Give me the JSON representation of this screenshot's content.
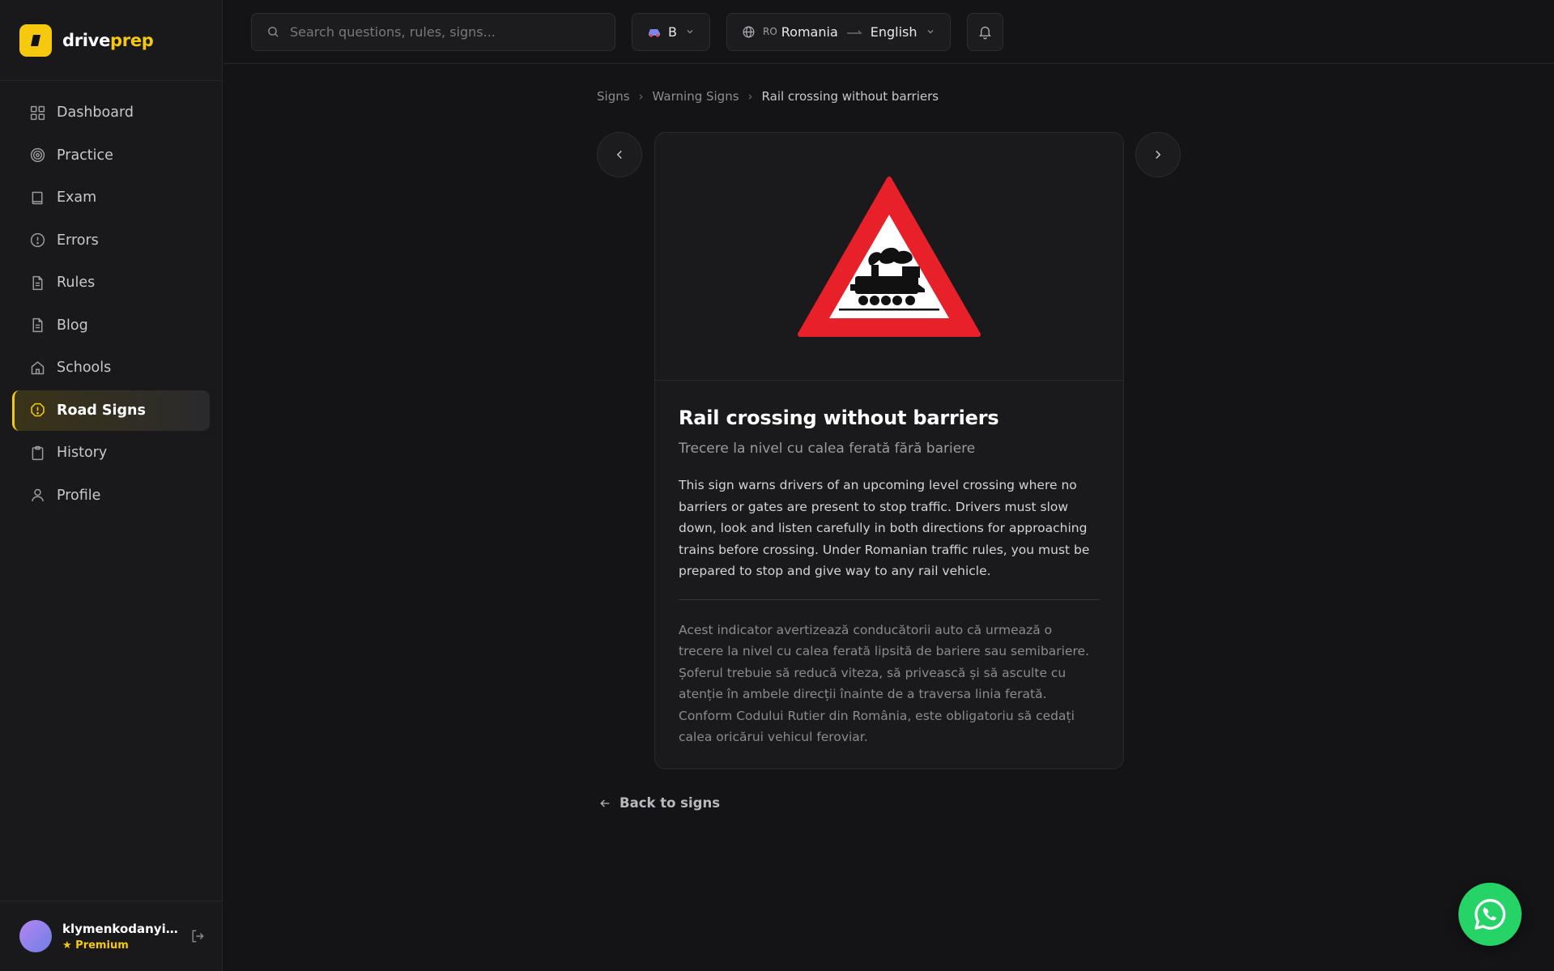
{
  "app": {
    "logo_part1": "drive",
    "logo_part2": "prep",
    "accent": "#f6c90e"
  },
  "sidebar": {
    "items": [
      {
        "label": "Dashboard",
        "icon": "grid-icon"
      },
      {
        "label": "Practice",
        "icon": "target-icon"
      },
      {
        "label": "Exam",
        "icon": "book-icon"
      },
      {
        "label": "Errors",
        "icon": "alert-circle-icon"
      },
      {
        "label": "Rules",
        "icon": "document-icon"
      },
      {
        "label": "Blog",
        "icon": "document-icon"
      },
      {
        "label": "Schools",
        "icon": "home-icon"
      },
      {
        "label": "Road Signs",
        "icon": "warning-octagon-icon",
        "active": true
      },
      {
        "label": "History",
        "icon": "clipboard-icon"
      },
      {
        "label": "Profile",
        "icon": "user-icon"
      }
    ]
  },
  "user": {
    "name": "klymenkodanyil0...",
    "plan": "★ Premium"
  },
  "topbar": {
    "search_placeholder": "Search questions, rules, signs...",
    "category": "B",
    "country_code": "RO",
    "country": "Romania",
    "language": "English"
  },
  "breadcrumb": {
    "level1": "Signs",
    "level2": "Warning Signs",
    "current": "Rail crossing without barriers"
  },
  "sign": {
    "title": "Rail crossing without barriers",
    "subtitle": "Trecere la nivel cu calea ferată fără bariere",
    "description_en": "This sign warns drivers of an upcoming level crossing where no barriers or gates are present to stop traffic. Drivers must slow down, look and listen carefully in both directions for approaching trains before crossing. Under Romanian traffic rules, you must be prepared to stop and give way to any rail vehicle.",
    "description_ro": "Acest indicator avertizează conducătorii auto că urmează o trecere la nivel cu calea ferată lipsită de bariere sau semibariere. Șoferul trebuie să reducă viteza, să privească și să asculte cu atenție în ambele direcții înainte de a traversa linia ferată. Conform Codului Rutier din România, este obligatoriu să cedați calea oricărui vehicul feroviar."
  },
  "back_label": "Back to signs",
  "colors": {
    "sign_red": "#e8202a",
    "whatsapp": "#25d366"
  }
}
